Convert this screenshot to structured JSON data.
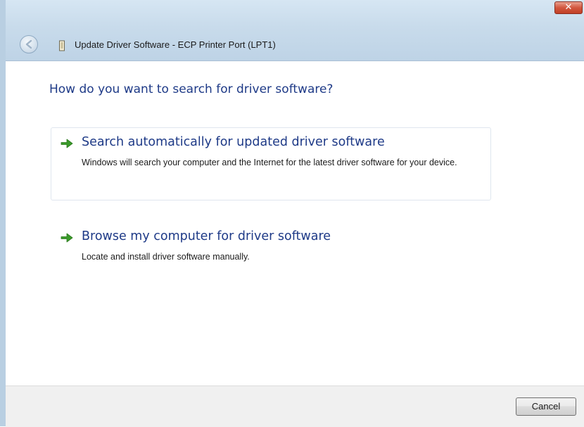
{
  "window": {
    "title": "Update Driver Software - ECP Printer Port (LPT1)",
    "close_glyph": "✕",
    "icons": {
      "close": "close-icon",
      "back": "back-arrow-icon",
      "device": "printer-port-icon"
    }
  },
  "content": {
    "main_instruction": "How do you want to search for driver software?",
    "options": [
      {
        "title": "Search automatically for updated driver software",
        "description": "Windows will search your computer and the Internet for the latest driver software for your device.",
        "icon": "green-arrow-icon"
      },
      {
        "title": "Browse my computer for driver software",
        "description": "Locate and install driver software manually.",
        "icon": "green-arrow-icon"
      }
    ]
  },
  "footer": {
    "cancel_label": "Cancel"
  },
  "colors": {
    "accent_text": "#1e3a87",
    "arrow_green": "#3a9a2a",
    "close_red": "#c13f26"
  }
}
